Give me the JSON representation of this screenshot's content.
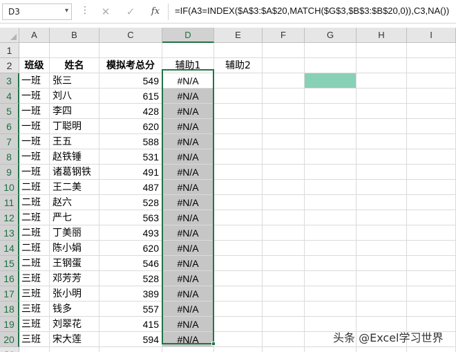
{
  "formula_bar": {
    "name_box": "D3",
    "name_box_arrow": "▾",
    "dots": "⋮",
    "cancel_glyph": "✕",
    "enter_glyph": "✓",
    "fx_label": "fx",
    "formula": "=IF(A3=INDEX($A$3:$A$20,MATCH($G$3,$B$3:$B$20,0)),C3,NA())"
  },
  "columns": [
    "A",
    "B",
    "C",
    "D",
    "E",
    "F",
    "G",
    "H",
    "I"
  ],
  "rows": [
    "1",
    "2",
    "3",
    "4",
    "5",
    "6",
    "7",
    "8",
    "9",
    "10",
    "11",
    "12",
    "13",
    "14",
    "15",
    "16",
    "17",
    "18",
    "19",
    "20",
    "21"
  ],
  "headers": {
    "class": "班级",
    "name": "姓名",
    "score": "模拟考总分",
    "aux1": "辅助1",
    "aux2": "辅助2"
  },
  "records": [
    {
      "cls": "一班",
      "name": "张三",
      "score": "549",
      "aux1": "#N/A"
    },
    {
      "cls": "一班",
      "name": "刘八",
      "score": "615",
      "aux1": "#N/A"
    },
    {
      "cls": "一班",
      "name": "李四",
      "score": "428",
      "aux1": "#N/A"
    },
    {
      "cls": "一班",
      "name": "丁聪明",
      "score": "620",
      "aux1": "#N/A"
    },
    {
      "cls": "一班",
      "name": "王五",
      "score": "588",
      "aux1": "#N/A"
    },
    {
      "cls": "一班",
      "name": "赵铁锤",
      "score": "531",
      "aux1": "#N/A"
    },
    {
      "cls": "一班",
      "name": "诸葛钢铁",
      "score": "491",
      "aux1": "#N/A"
    },
    {
      "cls": "二班",
      "name": "王二美",
      "score": "487",
      "aux1": "#N/A"
    },
    {
      "cls": "二班",
      "name": "赵六",
      "score": "528",
      "aux1": "#N/A"
    },
    {
      "cls": "二班",
      "name": "严七",
      "score": "563",
      "aux1": "#N/A"
    },
    {
      "cls": "二班",
      "name": "丁美丽",
      "score": "493",
      "aux1": "#N/A"
    },
    {
      "cls": "二班",
      "name": "陈小娟",
      "score": "620",
      "aux1": "#N/A"
    },
    {
      "cls": "二班",
      "name": "王钢蛋",
      "score": "546",
      "aux1": "#N/A"
    },
    {
      "cls": "三班",
      "name": "邓芳芳",
      "score": "528",
      "aux1": "#N/A"
    },
    {
      "cls": "三班",
      "name": "张小明",
      "score": "389",
      "aux1": "#N/A"
    },
    {
      "cls": "三班",
      "name": "钱多",
      "score": "557",
      "aux1": "#N/A"
    },
    {
      "cls": "三班",
      "name": "刘翠花",
      "score": "415",
      "aux1": "#N/A"
    },
    {
      "cls": "三班",
      "name": "宋大莲",
      "score": "594",
      "aux1": "#N/A"
    }
  ],
  "lookup_cell_color": "#88d1b6",
  "selection_color": "#217346",
  "watermark": "头条 @Excel学习世界"
}
